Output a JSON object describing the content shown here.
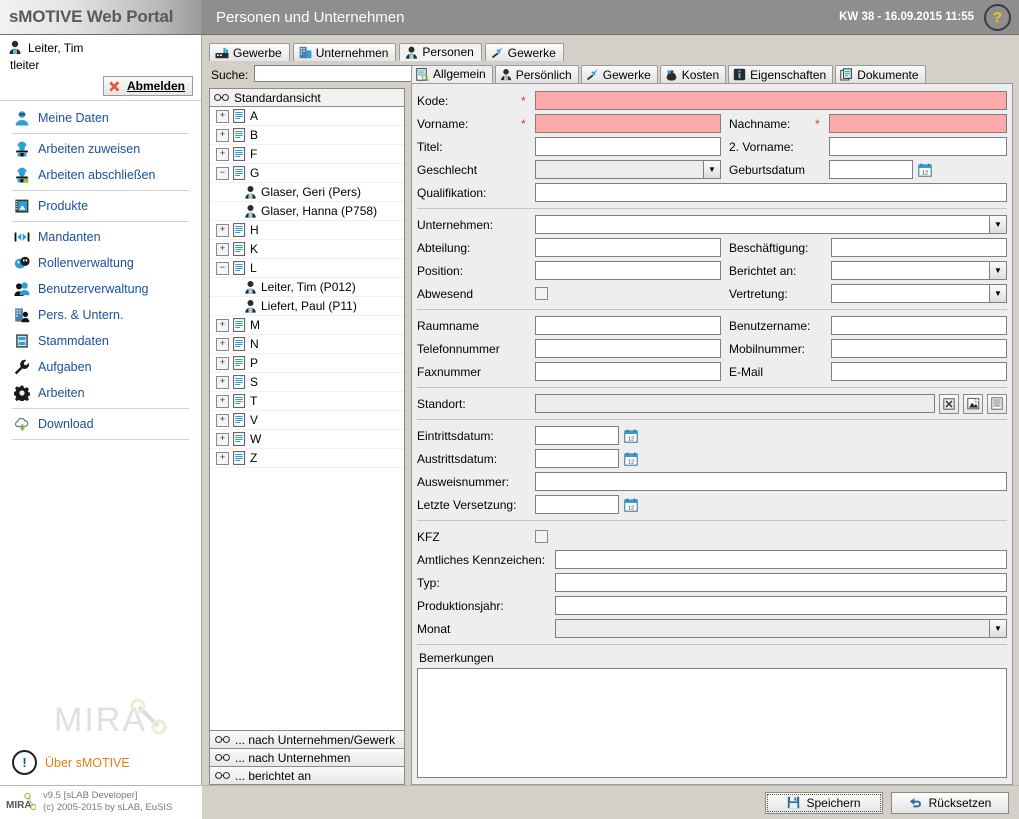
{
  "header": {
    "logo": "sMOTIVE Web Portal",
    "title": "Personen und Unternehmen",
    "date": "KW 38 - 16.09.2015 11:55",
    "help": "?"
  },
  "sidebar": {
    "user_name": "Leiter, Tim",
    "user_login": "tleiter",
    "logout_label": "Abmelden",
    "nav": [
      {
        "label": "Meine Daten",
        "icon": "user-circle-icon",
        "sep_after": true
      },
      {
        "label": "Arbeiten zuweisen",
        "icon": "worker-assign-icon",
        "sep_after": false
      },
      {
        "label": "Arbeiten abschließen",
        "icon": "worker-complete-icon",
        "sep_after": true
      },
      {
        "label": "Produkte",
        "icon": "product-book-icon",
        "sep_after": true
      },
      {
        "label": "Mandanten",
        "icon": "clients-arrows-icon",
        "sep_after": false
      },
      {
        "label": "Rollenverwaltung",
        "icon": "masks-roles-icon",
        "sep_after": false
      },
      {
        "label": "Benutzerverwaltung",
        "icon": "users-icon",
        "sep_after": false
      },
      {
        "label": "Pers. & Untern.",
        "icon": "building-person-icon",
        "sep_after": false
      },
      {
        "label": "Stammdaten",
        "icon": "database-icon",
        "sep_after": false
      },
      {
        "label": "Aufgaben",
        "icon": "wrench-icon",
        "sep_after": false
      },
      {
        "label": "Arbeiten",
        "icon": "gear-icon",
        "sep_after": true
      },
      {
        "label": "Download",
        "icon": "cloud-download-icon",
        "sep_after": true
      }
    ],
    "watermark": "MIRA",
    "about_label": "Über sMOTIVE",
    "footer_line1": "v9.5 [sLAB Developer]",
    "footer_line2": "(c) 2005-2015 by sLAB, EuSIS"
  },
  "main_tabs": [
    {
      "label": "Gewerbe",
      "icon": "factory-icon",
      "active": false
    },
    {
      "label": "Unternehmen",
      "icon": "building-icon",
      "active": false
    },
    {
      "label": "Personen",
      "icon": "person-icon",
      "active": true
    },
    {
      "label": "Gewerke",
      "icon": "hammer-icon",
      "active": false
    }
  ],
  "tree": {
    "search_label": "Suche:",
    "search_value": "",
    "header": "Standardansicht",
    "nodes": [
      {
        "label": "A",
        "type": "group",
        "expanded": false
      },
      {
        "label": "B",
        "type": "group",
        "expanded": false
      },
      {
        "label": "F",
        "type": "group",
        "expanded": false
      },
      {
        "label": "G",
        "type": "group",
        "expanded": true
      },
      {
        "label": "Glaser, Geri (Pers)",
        "type": "person"
      },
      {
        "label": "Glaser, Hanna (P758)",
        "type": "person"
      },
      {
        "label": "H",
        "type": "group",
        "expanded": false
      },
      {
        "label": "K",
        "type": "group",
        "expanded": false
      },
      {
        "label": "L",
        "type": "group",
        "expanded": true
      },
      {
        "label": "Leiter, Tim (P012)",
        "type": "person"
      },
      {
        "label": "Liefert, Paul (P11)",
        "type": "person"
      },
      {
        "label": "M",
        "type": "group",
        "expanded": false
      },
      {
        "label": "N",
        "type": "group",
        "expanded": false
      },
      {
        "label": "P",
        "type": "group",
        "expanded": false
      },
      {
        "label": "S",
        "type": "group",
        "expanded": false
      },
      {
        "label": "T",
        "type": "group",
        "expanded": false
      },
      {
        "label": "V",
        "type": "group",
        "expanded": false
      },
      {
        "label": "W",
        "type": "group",
        "expanded": false
      },
      {
        "label": "Z",
        "type": "group",
        "expanded": false
      }
    ],
    "view_buttons": [
      "... nach Unternehmen/Gewerk",
      "... nach Unternehmen",
      "... berichtet an"
    ]
  },
  "sub_tabs": [
    {
      "label": "Allgemein",
      "icon": "document-search-icon",
      "active": true
    },
    {
      "label": "Persönlich",
      "icon": "person-icon",
      "active": false
    },
    {
      "label": "Gewerke",
      "icon": "hammer-icon",
      "active": false
    },
    {
      "label": "Kosten",
      "icon": "money-bag-icon",
      "active": false
    },
    {
      "label": "Eigenschaften",
      "icon": "info-icon",
      "active": false
    },
    {
      "label": "Dokumente",
      "icon": "documents-icon",
      "active": false
    }
  ],
  "form": {
    "kode_label": "Kode:",
    "kode_value": "",
    "vorname_label": "Vorname:",
    "vorname_value": "",
    "nachname_label": "Nachname:",
    "nachname_value": "",
    "titel_label": "Titel:",
    "titel_value": "",
    "vorname2_label": "2. Vorname:",
    "vorname2_value": "",
    "geschlecht_label": "Geschlecht",
    "geschlecht_value": "",
    "geburtsdatum_label": "Geburtsdatum",
    "geburtsdatum_value": "",
    "qualifikation_label": "Qualifikation:",
    "qualifikation_value": "",
    "unternehmen_label": "Unternehmen:",
    "unternehmen_value": "",
    "abteilung_label": "Abteilung:",
    "abteilung_value": "",
    "beschaeftigung_label": "Beschäftigung:",
    "beschaeftigung_value": "",
    "position_label": "Position:",
    "position_value": "",
    "berichtet_an_label": "Berichtet an:",
    "berichtet_an_value": "",
    "abwesend_label": "Abwesend",
    "abwesend_checked": false,
    "vertretung_label": "Vertretung:",
    "vertretung_value": "",
    "raumname_label": "Raumname",
    "raumname_value": "",
    "benutzername_label": "Benutzername:",
    "benutzername_value": "",
    "telefonnummer_label": "Telefonnummer",
    "telefonnummer_value": "",
    "mobilnummer_label": "Mobilnummer:",
    "mobilnummer_value": "",
    "faxnummer_label": "Faxnummer",
    "faxnummer_value": "",
    "email_label": "E-Mail",
    "email_value": "",
    "standort_label": "Standort:",
    "standort_value": "",
    "eintrittsdatum_label": "Eintrittsdatum:",
    "eintrittsdatum_value": "",
    "austrittsdatum_label": "Austrittsdatum:",
    "austrittsdatum_value": "",
    "ausweisnummer_label": "Ausweisnummer:",
    "ausweisnummer_value": "",
    "letzte_versetzung_label": "Letzte Versetzung:",
    "letzte_versetzung_value": "",
    "kfz_label": "KFZ",
    "kfz_checked": false,
    "kennzeichen_label": "Amtliches Kennzeichen:",
    "kennzeichen_value": "",
    "typ_label": "Typ:",
    "typ_value": "",
    "produktionsjahr_label": "Produktionsjahr:",
    "produktionsjahr_value": "",
    "monat_label": "Monat",
    "monat_value": "",
    "bemerkungen_label": "Bemerkungen",
    "bemerkungen_value": "",
    "required_marker": "*",
    "standort_buttons": [
      "clear-icon",
      "map-icon",
      "list-icon"
    ]
  },
  "footer": {
    "save_label": "Speichern",
    "reset_label": "Rücksetzen"
  },
  "colors": {
    "header_bg": "#8e8e8e",
    "required_field": "#ffaaaa",
    "nav_link": "#1a4f9c",
    "about_orange": "#e08214",
    "help_yellow": "#f5c518"
  }
}
